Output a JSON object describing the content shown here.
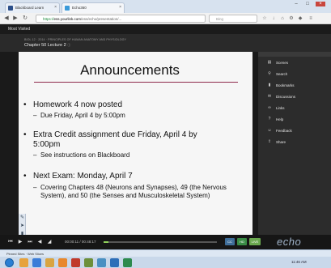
{
  "browser": {
    "tabs": [
      {
        "label": "Blackboard Learn",
        "active": false
      },
      {
        "label": "Echo360",
        "active": true
      }
    ],
    "address": {
      "scheme": "https://",
      "host": "ess.yourlink.com",
      "path": "/ess/echo/presentation/..."
    },
    "search_placeholder": "Bing",
    "bookmarks_bar": "Most Visited"
  },
  "player": {
    "course_line": "BIOL 12 · 2014 · PRINCIPLES OF HUMAN ANATOMY AND PHYSIOLOGY",
    "lecture_title": "Chapter 50 Lecture 2",
    "timecode": "00:00:11 / 00:48:17",
    "progress_fraction": 0.04,
    "mode_buttons": [
      "CC",
      "HD",
      "LIVE"
    ],
    "brand": "echo"
  },
  "slide": {
    "title": "Announcements",
    "bullets": [
      {
        "text": "Homework 4 now posted",
        "subs": [
          "Due Friday, April 4 by 5:00pm"
        ]
      },
      {
        "text": "Extra Credit assignment due Friday, April 4 by 5:00pm",
        "subs": [
          "See instructions on Blackboard"
        ]
      },
      {
        "text": "Next Exam:  Monday, April 7",
        "subs": [
          "Covering Chapters 48 (Neurons and Synapses), 49 (the Nervous System), and 50 (the Senses and Musculoskeletal System)"
        ]
      }
    ]
  },
  "side_menu": [
    {
      "label": "Scenes",
      "icon": "scenes-icon"
    },
    {
      "label": "Search",
      "icon": "search-icon"
    },
    {
      "label": "Bookmarks",
      "icon": "bookmark-icon"
    },
    {
      "label": "Discussions",
      "icon": "discussion-icon"
    },
    {
      "label": "Links",
      "icon": "link-icon"
    },
    {
      "label": "Help",
      "icon": "help-icon"
    },
    {
      "label": "Feedback",
      "icon": "feedback-icon"
    },
    {
      "label": "Share",
      "icon": "share-icon"
    }
  ],
  "taskbar": {
    "strip_text": "Pinned Sites · Web Slices",
    "tray_time": "11:46 AM"
  },
  "colors": {
    "slide_rule": "#8e2a4c",
    "progress": "#8fd05a",
    "mode_cc": "#3f6e9a",
    "mode_hd": "#3a8c46",
    "mode_live": "#6aa84f"
  }
}
